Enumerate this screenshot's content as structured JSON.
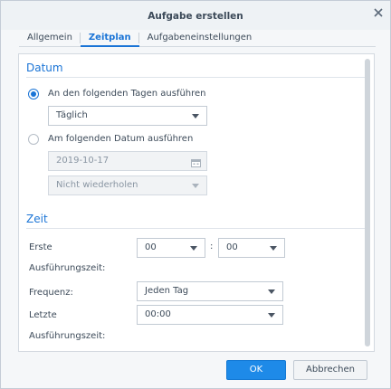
{
  "dialog": {
    "title": "Aufgabe erstellen",
    "close_icon": "close-icon"
  },
  "tabs": [
    {
      "label": "Allgemein",
      "active": false
    },
    {
      "label": "Zeitplan",
      "active": true
    },
    {
      "label": "Aufgabeneinstellungen",
      "active": false
    }
  ],
  "datum": {
    "section_title": "Datum",
    "option_days": {
      "label": "An den folgenden Tagen ausführen",
      "checked": true
    },
    "days_select": {
      "value": "Täglich"
    },
    "option_date": {
      "label": "Am folgenden Datum ausführen",
      "checked": false
    },
    "date_field": {
      "value": "2019-10-17",
      "icon": "calendar-icon"
    },
    "repeat_select": {
      "value": "Nicht wiederholen"
    }
  },
  "zeit": {
    "section_title": "Zeit",
    "first_run_label_1": "Erste",
    "first_run_label_2": "Ausführungszeit:",
    "hour_select": {
      "value": "00"
    },
    "time_colon": ":",
    "minute_select": {
      "value": "00"
    },
    "frequency_label": "Frequenz:",
    "frequency_select": {
      "value": "Jeden Tag"
    },
    "last_run_label_1": "Letzte",
    "last_run_label_2": "Ausführungszeit:",
    "last_run_select": {
      "value": "00:00"
    }
  },
  "footer": {
    "ok_label": "OK",
    "cancel_label": "Abbrechen"
  },
  "colors": {
    "accent": "#1a74d6",
    "ok_button": "#1e8ae8"
  }
}
